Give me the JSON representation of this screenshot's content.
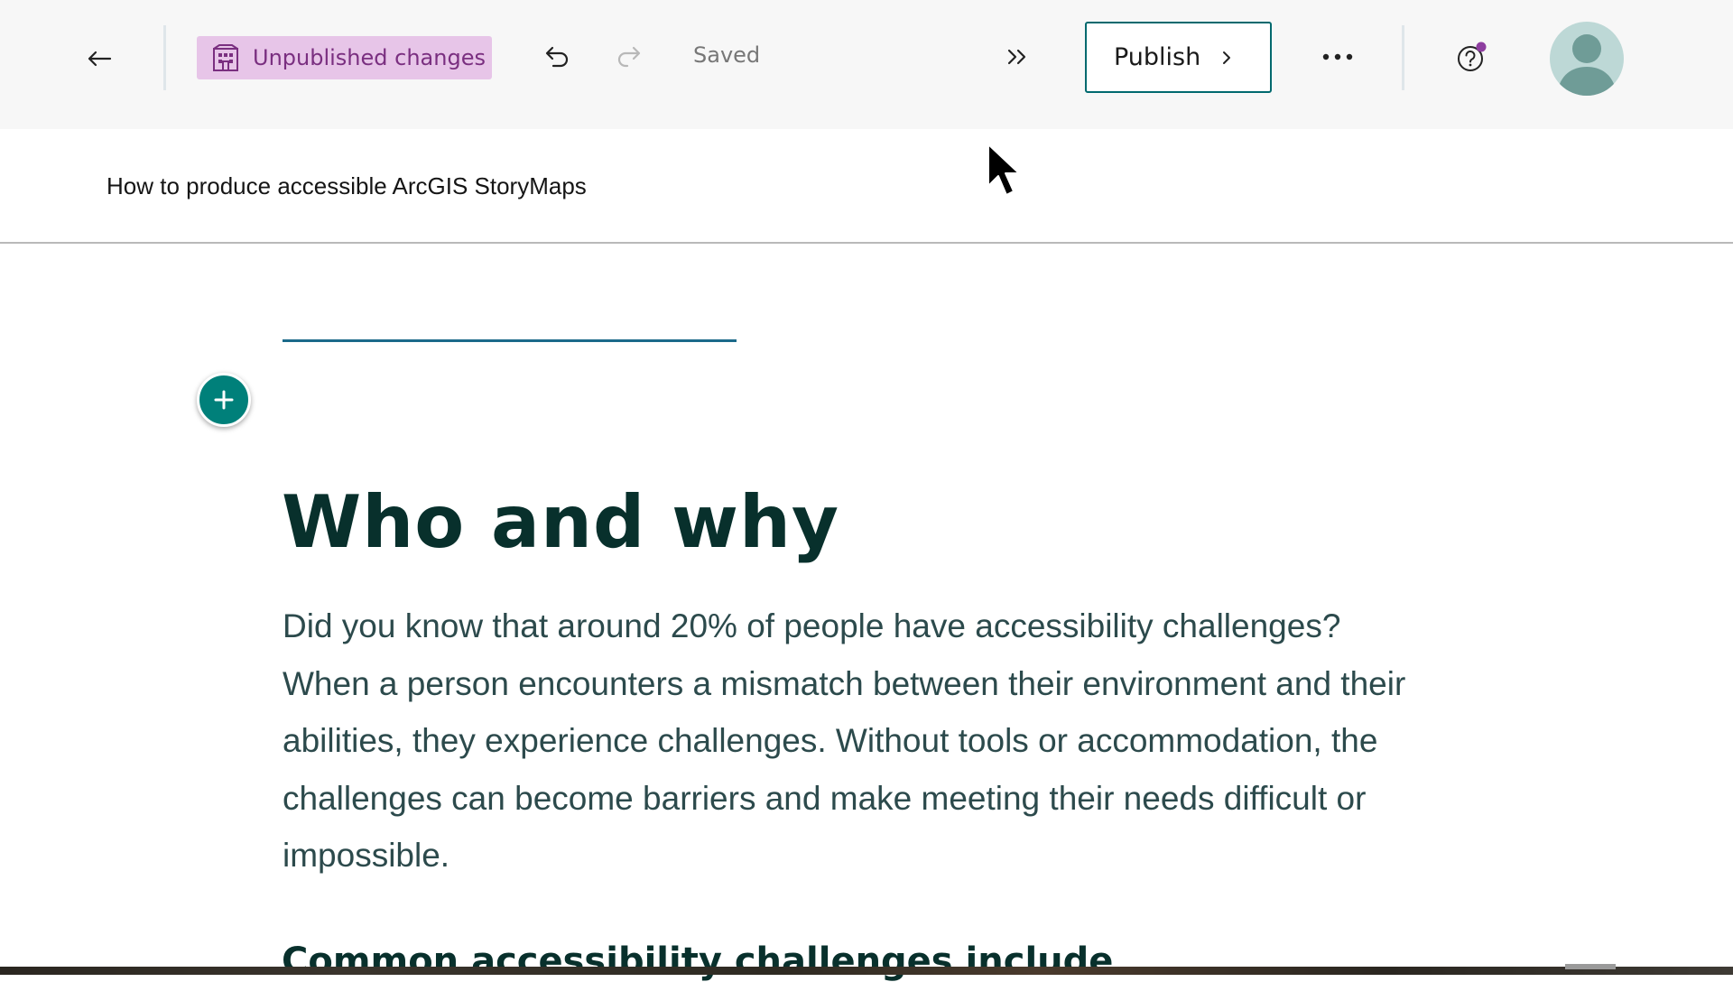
{
  "toolbar": {
    "back_icon": "arrow-left-icon",
    "status_badge_label": "Unpublished changes",
    "status_badge_icon": "building-icon",
    "undo_icon": "undo-icon",
    "redo_icon": "redo-icon",
    "save_status": "Saved",
    "expand_icon": "double-chevron-right-icon",
    "publish_label": "Publish",
    "more_icon": "more-horizontal-icon",
    "help_icon": "help-icon",
    "avatar_icon": "user-avatar-icon"
  },
  "colors": {
    "badge_bg": "#e7c5e8",
    "badge_text": "#7a2f80",
    "accent": "#00807a",
    "heading": "#08302c",
    "body": "#2c4a4c",
    "notification_dot": "#8e3ea0"
  },
  "story": {
    "title": "How to produce accessible ArcGIS StoryMaps"
  },
  "content": {
    "heading": "Who and why",
    "paragraph": "Did you know that around 20% of people have accessibility challenges? When a person encounters a mismatch between their environment and their abilities, they experience challenges. Without tools or accommodation, the challenges can become barriers and make meeting their needs difficult or impossible.",
    "next_heading": "Common accessibility challenges include"
  }
}
